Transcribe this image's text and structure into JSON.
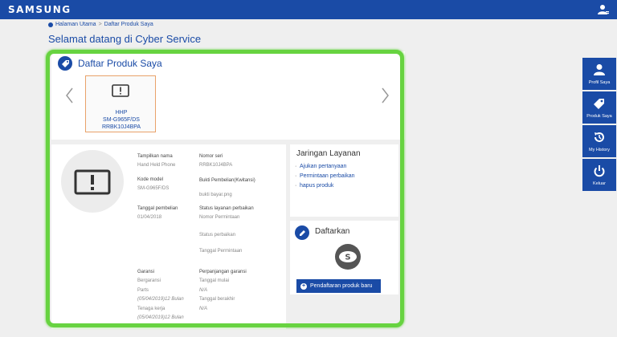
{
  "header": {
    "brand": "SAMSUNG",
    "user_icon": "user-icon",
    "color": "#1a4ba6"
  },
  "breadcrumb": {
    "home": "Halaman Utama",
    "sep": ">",
    "current": "Daftar Produk Saya"
  },
  "page_title": "Selamat datang di Cyber Service",
  "products": {
    "title": "Daftar Produk Saya",
    "card": {
      "icon": "alert-icon",
      "type": "HHP",
      "model": "SM-G965F/DS",
      "serial": "RRBK10J4BPA"
    }
  },
  "detail": {
    "icon": "alert-icon",
    "display_name_label": "Tampilkan nama",
    "display_name_value": "Hand Held Phone",
    "model_code_label": "Kode model",
    "model_code_value": "SM-G965F/DS",
    "purchase_date_label": "Tanggal pembelian",
    "purchase_date_value": "01/04/2018",
    "serial_label": "Nomor seri",
    "serial_value": "RRBK10J4BPA",
    "proof_label": "Bukti Pembelian(Kwitansi)",
    "proof_value": "bukti bayar.png",
    "repair_status_label": "Status layanan perbaikan",
    "request_number_label": "Nomor Permintaan",
    "repair_status_value": "Status perbaikan",
    "request_date_label": "Tanggal Permintaan",
    "warranty_label": "Garansi",
    "warranty_status": "Bergaransi",
    "parts_label": "Parts",
    "parts_value": "(05/04/2019)12 Bulan",
    "labor_label": "Tenaga kerja",
    "labor_value": "(05/04/2019)12 Bulan",
    "extension_label": "Perpanjangan garansi",
    "start_date_label": "Tanggal mulai",
    "start_date_value": "N/A",
    "end_date_label": "Tanggal berakhir",
    "end_date_value": "N/A"
  },
  "service": {
    "title": "Jaringan Layanan",
    "links": [
      "Ajukan pertanyaan",
      "Permintaan perbaikan",
      "hapus produk"
    ]
  },
  "register": {
    "title": "Daftarkan",
    "logo": "samsung-s-logo",
    "button": "Pendaftaran produk baru"
  },
  "side_menu": [
    {
      "label": "Profil Saya",
      "icon": "person-icon"
    },
    {
      "label": "Produk Saya",
      "icon": "tag-icon"
    },
    {
      "label": "My History",
      "icon": "history-icon"
    },
    {
      "label": "Keluar",
      "icon": "power-icon"
    }
  ],
  "highlight_color": "#67d340"
}
